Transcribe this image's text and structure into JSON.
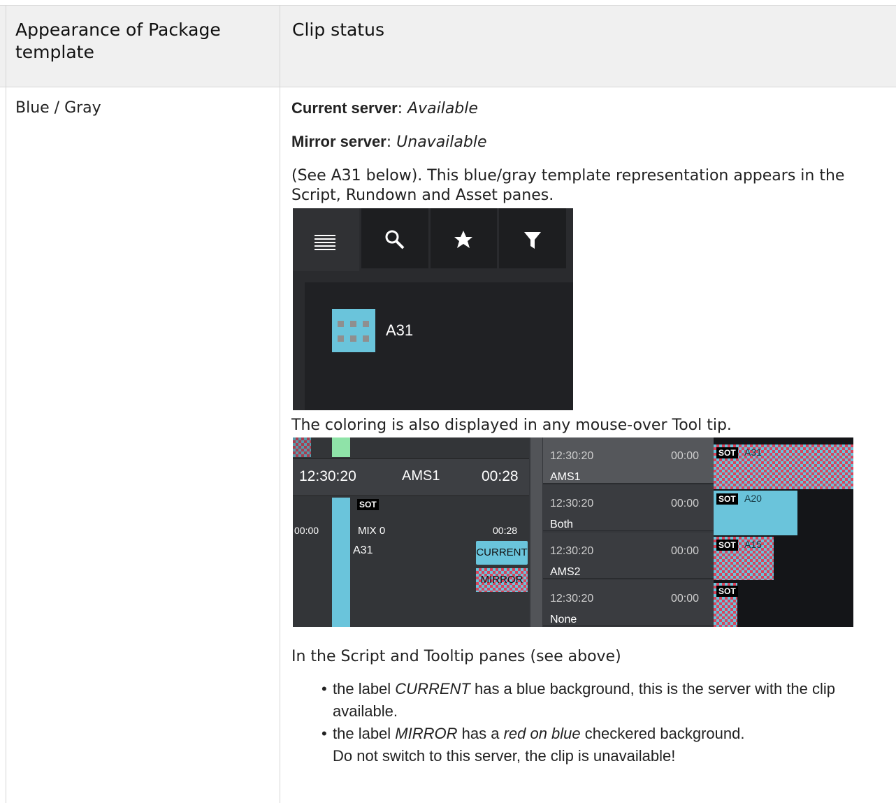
{
  "header": {
    "col1": "Appearance of Package template",
    "col2": "Clip status"
  },
  "row": {
    "appearance": "Blue / Gray",
    "current_label": "Current server",
    "current_value": "Available",
    "mirror_label": "Mirror server",
    "mirror_value": "Unavailable",
    "see_text": "(See A31 below). This blue/gray template representation appears in the Script, Rundown and Asset panes.",
    "asset_clip": "A31",
    "tooltip_text": "The coloring is also displayed in any mouse-over Tool tip.",
    "script_note": "In the Script and Tooltip panes (see above)",
    "bullets": [
      {
        "pre": "the label ",
        "em": "CURRENT",
        "post": " has a blue background, this is the server with the clip available."
      },
      {
        "pre": "the label ",
        "em": "MIRROR",
        "post": " has a ",
        "em2": "red on blue",
        "post2": " checkered background.",
        "line2": "Do not switch to this server, the clip is unavailable!"
      }
    ]
  },
  "tooltip_shot": {
    "time": "12:30:20",
    "server": "AMS1",
    "duration": "00:28",
    "sot": "SOT",
    "start": "00:00",
    "mix": "MIX 0",
    "clip": "A31",
    "end": "00:28",
    "current": "CURRENT",
    "mirror": "MIRROR",
    "rows": [
      {
        "time": "12:30:20",
        "dur": "00:00",
        "name": "AMS1",
        "clip": "A31"
      },
      {
        "time": "12:30:20",
        "dur": "00:00",
        "name": "Both",
        "clip": "A20"
      },
      {
        "time": "12:30:20",
        "dur": "00:00",
        "name": "AMS2",
        "clip": "A15"
      },
      {
        "time": "12:30:20",
        "dur": "00:00",
        "name": "None",
        "clip": ""
      }
    ]
  },
  "colors": {
    "clip_blue": "#6ac4db",
    "checker_red": "#d9435b",
    "header_bg": "#f0f0f0"
  },
  "icons": [
    "list-icon",
    "search-icon",
    "star-icon",
    "filter-icon"
  ]
}
